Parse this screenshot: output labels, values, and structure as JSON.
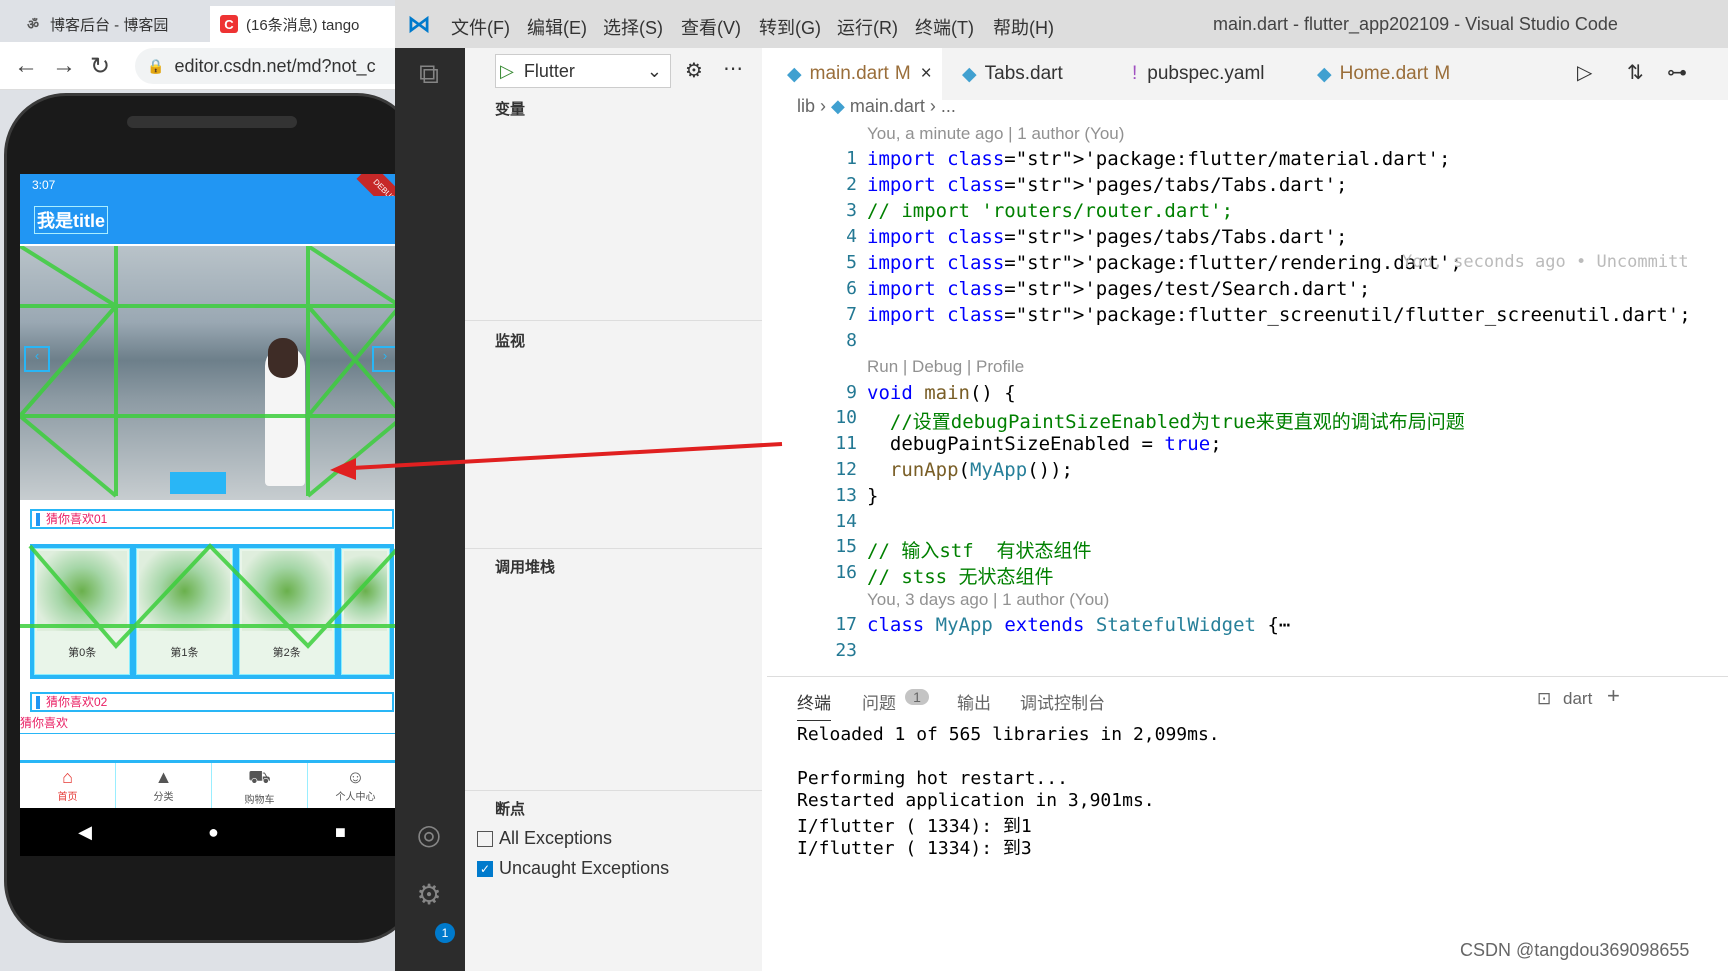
{
  "chrome": {
    "tabs": [
      {
        "label": "博客后台 - 博客园",
        "favicon": "dog-icon"
      },
      {
        "label": "(16条消息) tango",
        "favicon": "csdn-icon",
        "favicon_text": "C"
      }
    ],
    "url": "editor.csdn.net/md?not_c"
  },
  "phone": {
    "time": "3:07",
    "debug_ribbon": "DEBUG",
    "app_title": "我是title",
    "section1": "猜你喜欢01",
    "section2": "猜你喜欢02",
    "section3": "猜你喜欢",
    "cards": [
      "第0条",
      "第1条",
      "第2条",
      ""
    ],
    "bottom_nav": [
      {
        "icon": "home-icon",
        "label": "首页"
      },
      {
        "icon": "category-icon",
        "label": "分类"
      },
      {
        "icon": "cart-icon",
        "label": "购物车"
      },
      {
        "icon": "people-icon",
        "label": "个人中心"
      }
    ]
  },
  "vscode": {
    "menus": [
      "文件(F)",
      "编辑(E)",
      "选择(S)",
      "查看(V)",
      "转到(G)",
      "运行(R)",
      "终端(T)",
      "帮助(H)"
    ],
    "window_title": "main.dart - flutter_app202109 - Visual Studio Code",
    "run_config": "Flutter",
    "sidebar": {
      "variables": "变量",
      "watch": "监视",
      "callstack": "调用堆栈",
      "breakpoints": "断点",
      "all_exceptions": "All Exceptions",
      "uncaught_exceptions": "Uncaught Exceptions",
      "badge": "1"
    },
    "tabs": [
      {
        "label": "main.dart",
        "mark": "M",
        "active": true
      },
      {
        "label": "Tabs.dart",
        "mark": "",
        "active": false
      },
      {
        "label": "pubspec.yaml",
        "mark": "",
        "active": false
      },
      {
        "label": "Home.dart",
        "mark": "M",
        "active": false
      }
    ],
    "breadcrumb_lib": "lib",
    "breadcrumb_file": "main.dart",
    "breadcrumb_more": "...",
    "lens1": "You, a minute ago | 1 author (You)",
    "lens2": "Run | Debug | Profile",
    "lens3": "You, 3 days ago | 1 author (You)",
    "blame": "You, seconds ago • Uncommitt",
    "lines": [
      {
        "n": "1",
        "code": "import 'package:flutter/material.dart';"
      },
      {
        "n": "2",
        "code": "import 'pages/tabs/Tabs.dart';"
      },
      {
        "n": "3",
        "code": "// import 'routers/router.dart';"
      },
      {
        "n": "4",
        "code": "import 'pages/tabs/Tabs.dart';"
      },
      {
        "n": "5",
        "code": "import 'package:flutter/rendering.dart';"
      },
      {
        "n": "6",
        "code": "import 'pages/test/Search.dart';"
      },
      {
        "n": "7",
        "code": "import 'package:flutter_screenutil/flutter_screenutil.dart';"
      },
      {
        "n": "8",
        "code": ""
      },
      {
        "n": "9",
        "code": "void main() {"
      },
      {
        "n": "10",
        "code": "  //设置debugPaintSizeEnabled为true来更直观的调试布局问题"
      },
      {
        "n": "11",
        "code": "  debugPaintSizeEnabled = true;"
      },
      {
        "n": "12",
        "code": "  runApp(MyApp());"
      },
      {
        "n": "13",
        "code": "}"
      },
      {
        "n": "14",
        "code": ""
      },
      {
        "n": "15",
        "code": "// 输入stf  有状态组件"
      },
      {
        "n": "16",
        "code": "// stss 无状态组件"
      },
      {
        "n": "17",
        "code": "class MyApp extends StatefulWidget {⋯"
      },
      {
        "n": "23",
        "code": ""
      }
    ],
    "panel": {
      "tabs": [
        "终端",
        "问题",
        "输出",
        "调试控制台"
      ],
      "problems_count": "1",
      "terminal_name": "dart",
      "output": [
        "Reloaded 1 of 565 libraries in 2,099ms.",
        "",
        "Performing hot restart...",
        "Restarted application in 3,901ms.",
        "I/flutter ( 1334): 到1",
        "I/flutter ( 1334): 到3"
      ]
    }
  },
  "watermark": "CSDN @tangdou369098655"
}
